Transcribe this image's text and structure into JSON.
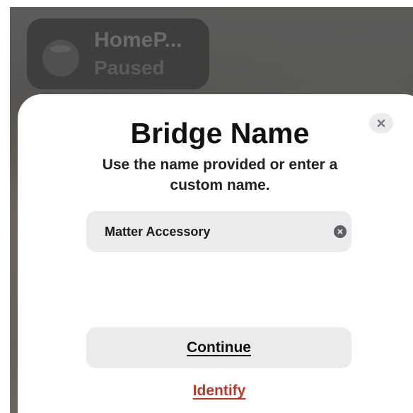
{
  "background_card": {
    "title": "HomeP...",
    "status": "Paused",
    "icon": "homepod-icon"
  },
  "sheet": {
    "title": "Bridge Name",
    "subtitle": "Use the name provided or enter a custom name.",
    "close_icon": "close-icon"
  },
  "name_field": {
    "value": "Matter Accessory",
    "clear_icon": "clear-circle-icon"
  },
  "buttons": {
    "continue_label": "Continue",
    "identify_label": "Identify"
  },
  "colors": {
    "link_red": "#b63a2c",
    "field_bg": "#ebebed"
  }
}
